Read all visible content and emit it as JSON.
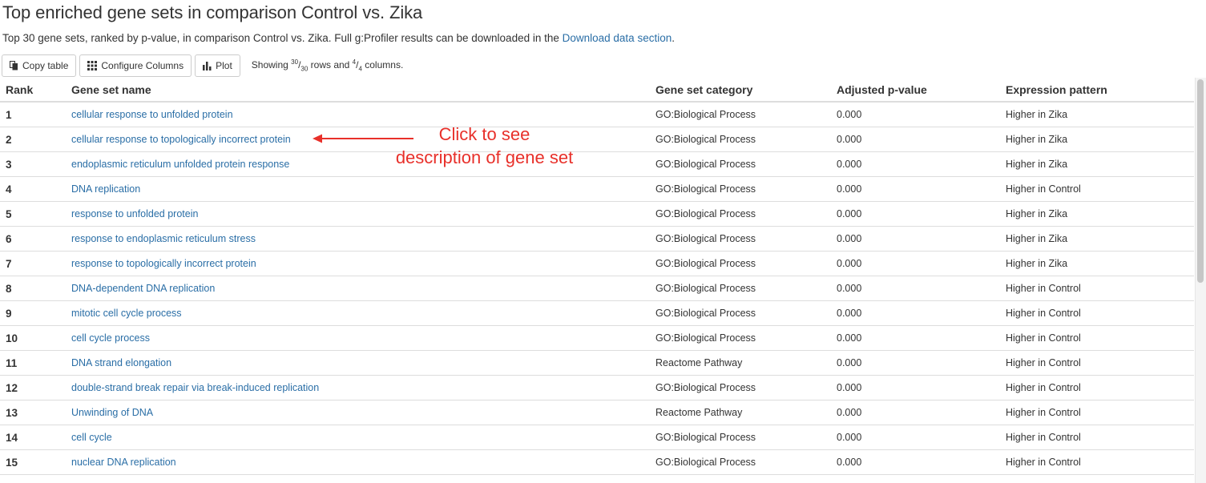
{
  "page": {
    "title": "Top enriched gene sets in comparison Control vs. Zika",
    "subtitle_text": "Top 30 gene sets, ranked by p-value, in comparison Control vs. Zika. Full g:Profiler results can be downloaded in the ",
    "subtitle_link": "Download data section",
    "subtitle_end": "."
  },
  "toolbar": {
    "copy_label": "Copy table",
    "configure_label": "Configure Columns",
    "plot_label": "Plot",
    "showing_prefix": "Showing ",
    "rows_shown": "30",
    "rows_total": "30",
    "rows_label": " rows and ",
    "cols_shown": "4",
    "cols_total": "4",
    "cols_label": " columns."
  },
  "table": {
    "headers": [
      "Rank",
      "Gene set name",
      "Gene set category",
      "Adjusted p-value",
      "Expression pattern"
    ],
    "rows": [
      {
        "rank": "1",
        "name": "cellular response to unfolded protein",
        "category": "GO:Biological Process",
        "pvalue": "0.000",
        "pattern": "Higher in Zika"
      },
      {
        "rank": "2",
        "name": "cellular response to topologically incorrect protein",
        "category": "GO:Biological Process",
        "pvalue": "0.000",
        "pattern": "Higher in Zika"
      },
      {
        "rank": "3",
        "name": "endoplasmic reticulum unfolded protein response",
        "category": "GO:Biological Process",
        "pvalue": "0.000",
        "pattern": "Higher in Zika"
      },
      {
        "rank": "4",
        "name": "DNA replication",
        "category": "GO:Biological Process",
        "pvalue": "0.000",
        "pattern": "Higher in Control"
      },
      {
        "rank": "5",
        "name": "response to unfolded protein",
        "category": "GO:Biological Process",
        "pvalue": "0.000",
        "pattern": "Higher in Zika"
      },
      {
        "rank": "6",
        "name": "response to endoplasmic reticulum stress",
        "category": "GO:Biological Process",
        "pvalue": "0.000",
        "pattern": "Higher in Zika"
      },
      {
        "rank": "7",
        "name": "response to topologically incorrect protein",
        "category": "GO:Biological Process",
        "pvalue": "0.000",
        "pattern": "Higher in Zika"
      },
      {
        "rank": "8",
        "name": "DNA-dependent DNA replication",
        "category": "GO:Biological Process",
        "pvalue": "0.000",
        "pattern": "Higher in Control"
      },
      {
        "rank": "9",
        "name": "mitotic cell cycle process",
        "category": "GO:Biological Process",
        "pvalue": "0.000",
        "pattern": "Higher in Control"
      },
      {
        "rank": "10",
        "name": "cell cycle process",
        "category": "GO:Biological Process",
        "pvalue": "0.000",
        "pattern": "Higher in Control"
      },
      {
        "rank": "11",
        "name": "DNA strand elongation",
        "category": "Reactome Pathway",
        "pvalue": "0.000",
        "pattern": "Higher in Control"
      },
      {
        "rank": "12",
        "name": "double-strand break repair via break-induced replication",
        "category": "GO:Biological Process",
        "pvalue": "0.000",
        "pattern": "Higher in Control"
      },
      {
        "rank": "13",
        "name": "Unwinding of DNA",
        "category": "Reactome Pathway",
        "pvalue": "0.000",
        "pattern": "Higher in Control"
      },
      {
        "rank": "14",
        "name": "cell cycle",
        "category": "GO:Biological Process",
        "pvalue": "0.000",
        "pattern": "Higher in Control"
      },
      {
        "rank": "15",
        "name": "nuclear DNA replication",
        "category": "GO:Biological Process",
        "pvalue": "0.000",
        "pattern": "Higher in Control"
      }
    ]
  },
  "annotation": {
    "line1": "Click to see",
    "line2": "description of gene set",
    "color": "#e8302a"
  },
  "icons": {
    "copy": "copy-icon",
    "configure": "grid-icon",
    "plot": "bar-chart-icon"
  },
  "colors": {
    "link": "#2a6ea6",
    "text": "#333333",
    "border": "#dddddd"
  }
}
